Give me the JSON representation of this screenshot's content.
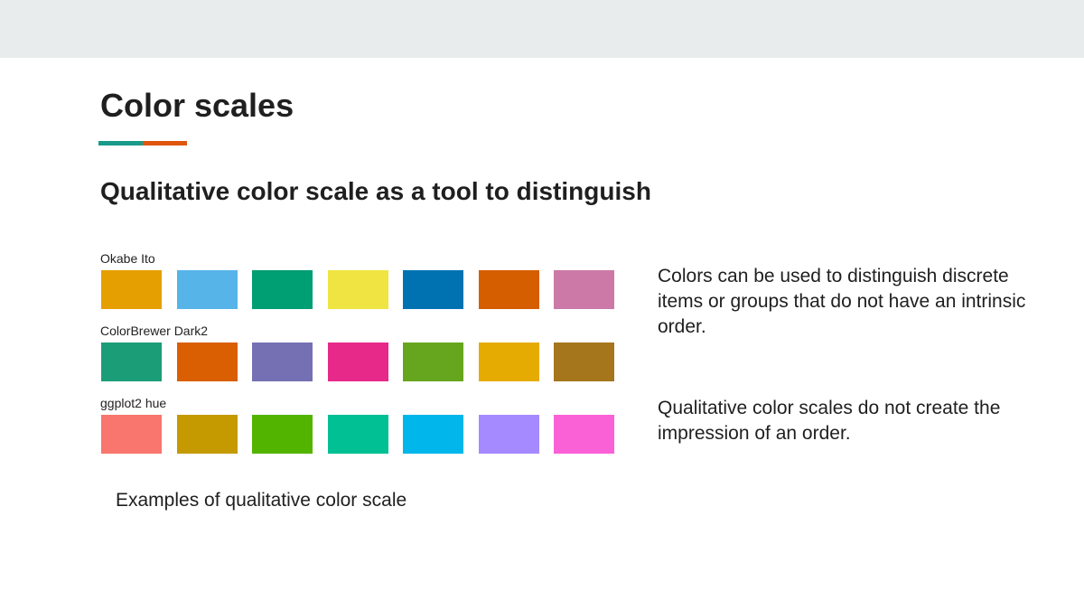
{
  "slide": {
    "title": "Color scales",
    "subtitle": "Qualitative color scale as a tool to distinguish",
    "caption": "Examples of qualitative color scale",
    "accent_colors": [
      "#1a9a8a",
      "#e0560f"
    ],
    "palettes": [
      {
        "name": "Okabe Ito",
        "colors": [
          "#E69F00",
          "#56B4E9",
          "#009E73",
          "#F0E442",
          "#0072B2",
          "#D55E00",
          "#CC79A7"
        ]
      },
      {
        "name": "ColorBrewer Dark2",
        "colors": [
          "#1B9E77",
          "#D95F02",
          "#7570B3",
          "#E7298A",
          "#66A61E",
          "#E6AB02",
          "#A6761D"
        ]
      },
      {
        "name": "ggplot2 hue",
        "colors": [
          "#F8766D",
          "#C49A00",
          "#53B400",
          "#00C094",
          "#00B6EB",
          "#A58AFF",
          "#FB61D7"
        ]
      }
    ],
    "notes": [
      "Colors can be used to distinguish discrete items or groups that do not have an intrinsic order.",
      "Qualitative color scales do not create the impression of an order."
    ]
  }
}
